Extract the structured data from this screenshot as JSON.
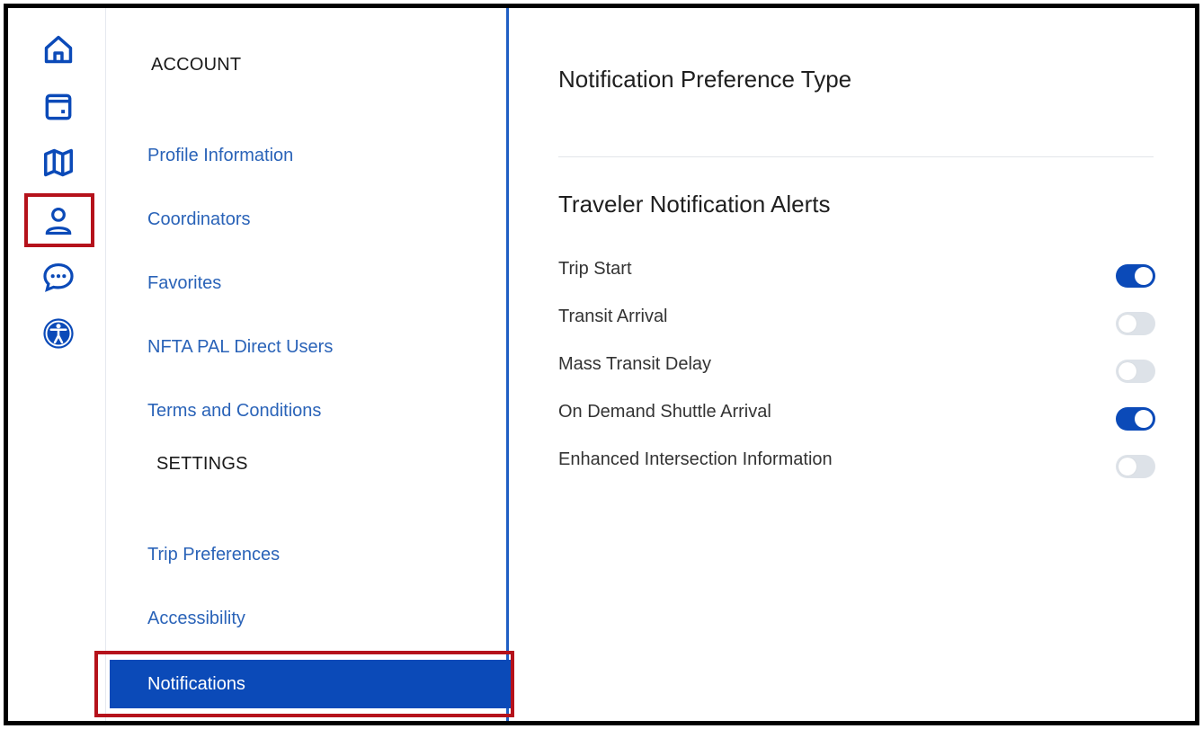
{
  "rail": {
    "icons": [
      "home-icon",
      "calendar-icon",
      "map-icon",
      "user-icon",
      "chat-icon",
      "accessibility-icon"
    ],
    "active": "user-icon",
    "highlight_color": "#b5121b"
  },
  "menu": {
    "account_header": "ACCOUNT",
    "account_items": [
      {
        "label": "Profile Information"
      },
      {
        "label": "Coordinators"
      },
      {
        "label": "Favorites"
      },
      {
        "label": "NFTA PAL Direct Users"
      },
      {
        "label": "Terms and Conditions"
      }
    ],
    "settings_header": "SETTINGS",
    "settings_items": [
      {
        "label": "Trip Preferences"
      },
      {
        "label": "Accessibility"
      },
      {
        "label": "Notifications",
        "active": true
      }
    ],
    "accent": "#0b4ab8",
    "link_color": "#2a63b8"
  },
  "content": {
    "title": "Notification Preference Type",
    "subtitle": "Traveler Notification Alerts",
    "alerts": [
      {
        "label": "Trip Start",
        "enabled": true
      },
      {
        "label": "Transit Arrival",
        "enabled": false
      },
      {
        "label": "Mass Transit Delay",
        "enabled": false
      },
      {
        "label": "On Demand Shuttle Arrival",
        "enabled": true
      },
      {
        "label": "Enhanced Intersection Information",
        "enabled": false
      }
    ]
  }
}
